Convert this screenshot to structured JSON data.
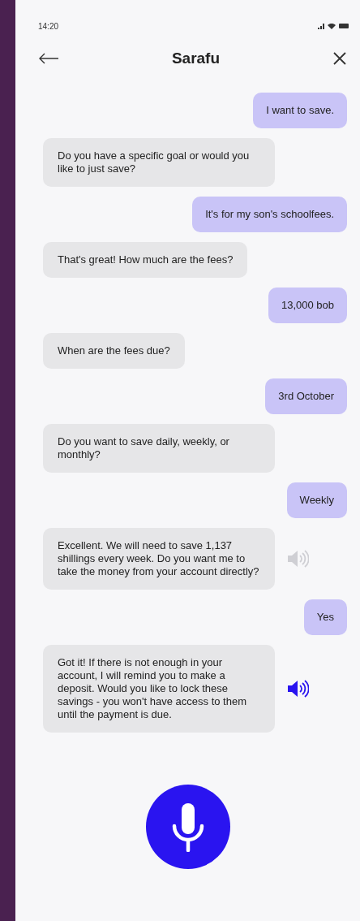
{
  "status_bar": {
    "time": "14:20"
  },
  "header": {
    "title": "Sarafu"
  },
  "messages": [
    {
      "kind": "user",
      "text": "I want to save."
    },
    {
      "kind": "bot",
      "text": "Do you have a specific goal or would you like to just save?"
    },
    {
      "kind": "user",
      "text": "It's for my son's schoolfees."
    },
    {
      "kind": "bot",
      "text": "That's great! How much are the fees?"
    },
    {
      "kind": "user",
      "text": "13,000 bob"
    },
    {
      "kind": "bot",
      "text": "When are the fees due?"
    },
    {
      "kind": "user",
      "text": "3rd October"
    },
    {
      "kind": "bot",
      "text": "Do you want to save daily, weekly, or monthly?"
    },
    {
      "kind": "user",
      "text": "Weekly"
    },
    {
      "kind": "bot",
      "text": "Excellent. We will need to save 1,137 shillings every week. Do you want me to take the money from your account directly?",
      "audio": {
        "playing": false
      }
    },
    {
      "kind": "user",
      "text": "Yes"
    },
    {
      "kind": "bot",
      "text": "Got it! If there is not enough in your account, I will remind you to make a deposit. Would you like to lock these savings - you won't have access to them until the payment is due.",
      "audio": {
        "playing": true
      }
    }
  ]
}
